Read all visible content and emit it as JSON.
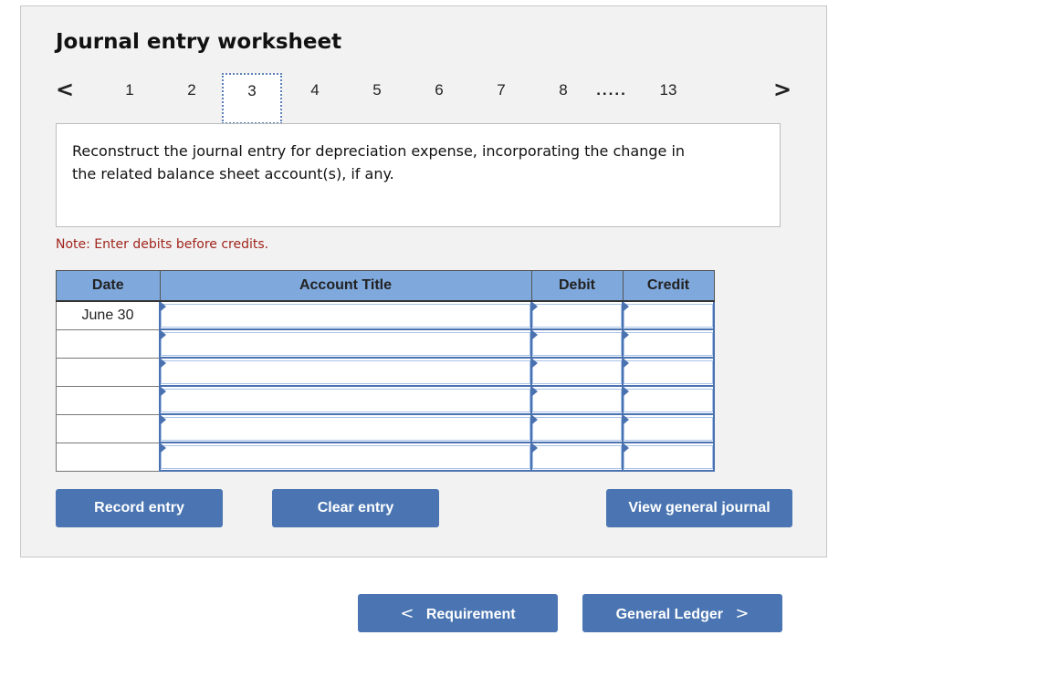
{
  "worksheet": {
    "title": "Journal entry worksheet",
    "pager": {
      "prev_icon": "chevron-left",
      "next_icon": "chevron-right",
      "prev_glyph": "<",
      "next_glyph": ">",
      "pages": [
        "1",
        "2",
        "3",
        "4",
        "5",
        "6",
        "7",
        "8"
      ],
      "ellipsis": ".....",
      "last_page": "13",
      "active_page": "3"
    },
    "prompt": "Reconstruct the journal entry for depreciation expense, incorporating the change in the related balance sheet account(s), if any.",
    "note": "Note: Enter debits before credits.",
    "table": {
      "headers": [
        "Date",
        "Account Title",
        "Debit",
        "Credit"
      ],
      "rows": [
        {
          "date": "June 30",
          "account": "",
          "debit": "",
          "credit": ""
        },
        {
          "date": "",
          "account": "",
          "debit": "",
          "credit": ""
        },
        {
          "date": "",
          "account": "",
          "debit": "",
          "credit": ""
        },
        {
          "date": "",
          "account": "",
          "debit": "",
          "credit": ""
        },
        {
          "date": "",
          "account": "",
          "debit": "",
          "credit": ""
        },
        {
          "date": "",
          "account": "",
          "debit": "",
          "credit": ""
        }
      ]
    },
    "buttons": {
      "record": "Record entry",
      "clear": "Clear entry",
      "view_journal": "View general journal"
    }
  },
  "nav": {
    "prev_label": "Requirement",
    "next_label": "General Ledger",
    "prev_glyph": "<",
    "next_glyph": ">"
  },
  "colors": {
    "accent": "#4a75b2",
    "header_bg": "#7fa8dc",
    "note": "#a0251c",
    "panel_bg": "#f2f2f2"
  }
}
